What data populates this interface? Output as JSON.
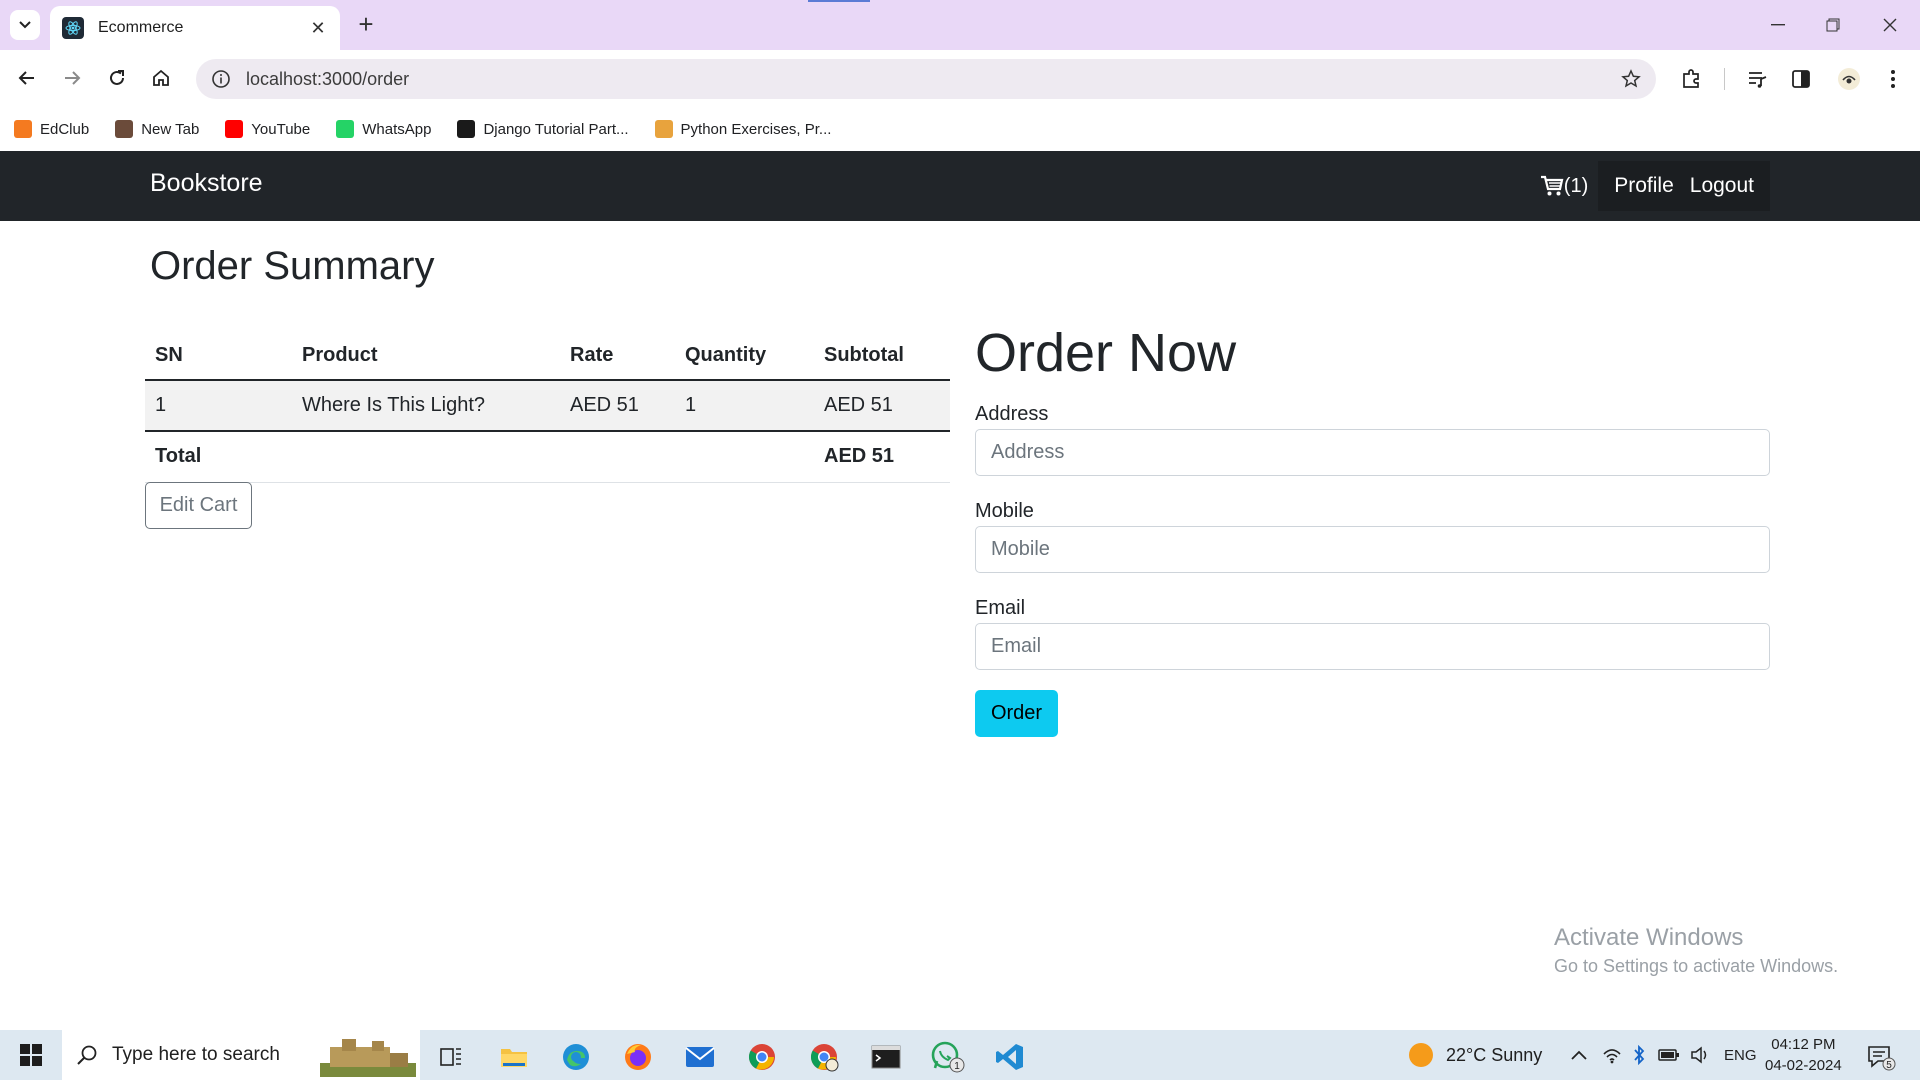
{
  "browser": {
    "tab_title": "Ecommerce",
    "url": "localhost:3000/order",
    "bookmarks": [
      {
        "label": "EdClub",
        "icon": "edclub-icon",
        "color": "#f47a20"
      },
      {
        "label": "New Tab",
        "icon": "new-tab-icon",
        "color": "#6b4b3a"
      },
      {
        "label": "YouTube",
        "icon": "youtube-icon",
        "color": "#ff0000"
      },
      {
        "label": "WhatsApp",
        "icon": "whatsapp-icon",
        "color": "#25d366"
      },
      {
        "label": "Django Tutorial Part...",
        "icon": "django-icon",
        "color": "#1a1a1a"
      },
      {
        "label": "Python Exercises, Pr...",
        "icon": "python-exercises-icon",
        "color": "#e8a33d"
      }
    ]
  },
  "navbar": {
    "brand": "Bookstore",
    "cart_count": "(1)",
    "profile": "Profile",
    "logout": "Logout"
  },
  "summary": {
    "title": "Order Summary",
    "headers": [
      "SN",
      "Product",
      "Rate",
      "Quantity",
      "Subtotal"
    ],
    "rows": [
      {
        "sn": "1",
        "product": "Where Is This Light?",
        "rate": "AED 51",
        "quantity": "1",
        "subtotal": "AED 51"
      }
    ],
    "total_label": "Total",
    "total_value": "AED 51",
    "edit_cart": "Edit Cart"
  },
  "order_form": {
    "heading": "Order Now",
    "address_label": "Address",
    "address_placeholder": "Address",
    "mobile_label": "Mobile",
    "mobile_placeholder": "Mobile",
    "email_label": "Email",
    "email_placeholder": "Email",
    "submit": "Order"
  },
  "watermark": {
    "title": "Activate Windows",
    "subtitle": "Go to Settings to activate Windows."
  },
  "taskbar": {
    "search_placeholder": "Type here to search",
    "weather": "22°C  Sunny",
    "language": "ENG",
    "time": "04:12 PM",
    "date": "04-02-2024",
    "whatsapp_badge": "1",
    "notification_count": "5"
  },
  "colors": {
    "navbar_bg": "#212529",
    "order_button": "#0dcaf0",
    "tabbar_bg": "#e9d8f7"
  }
}
